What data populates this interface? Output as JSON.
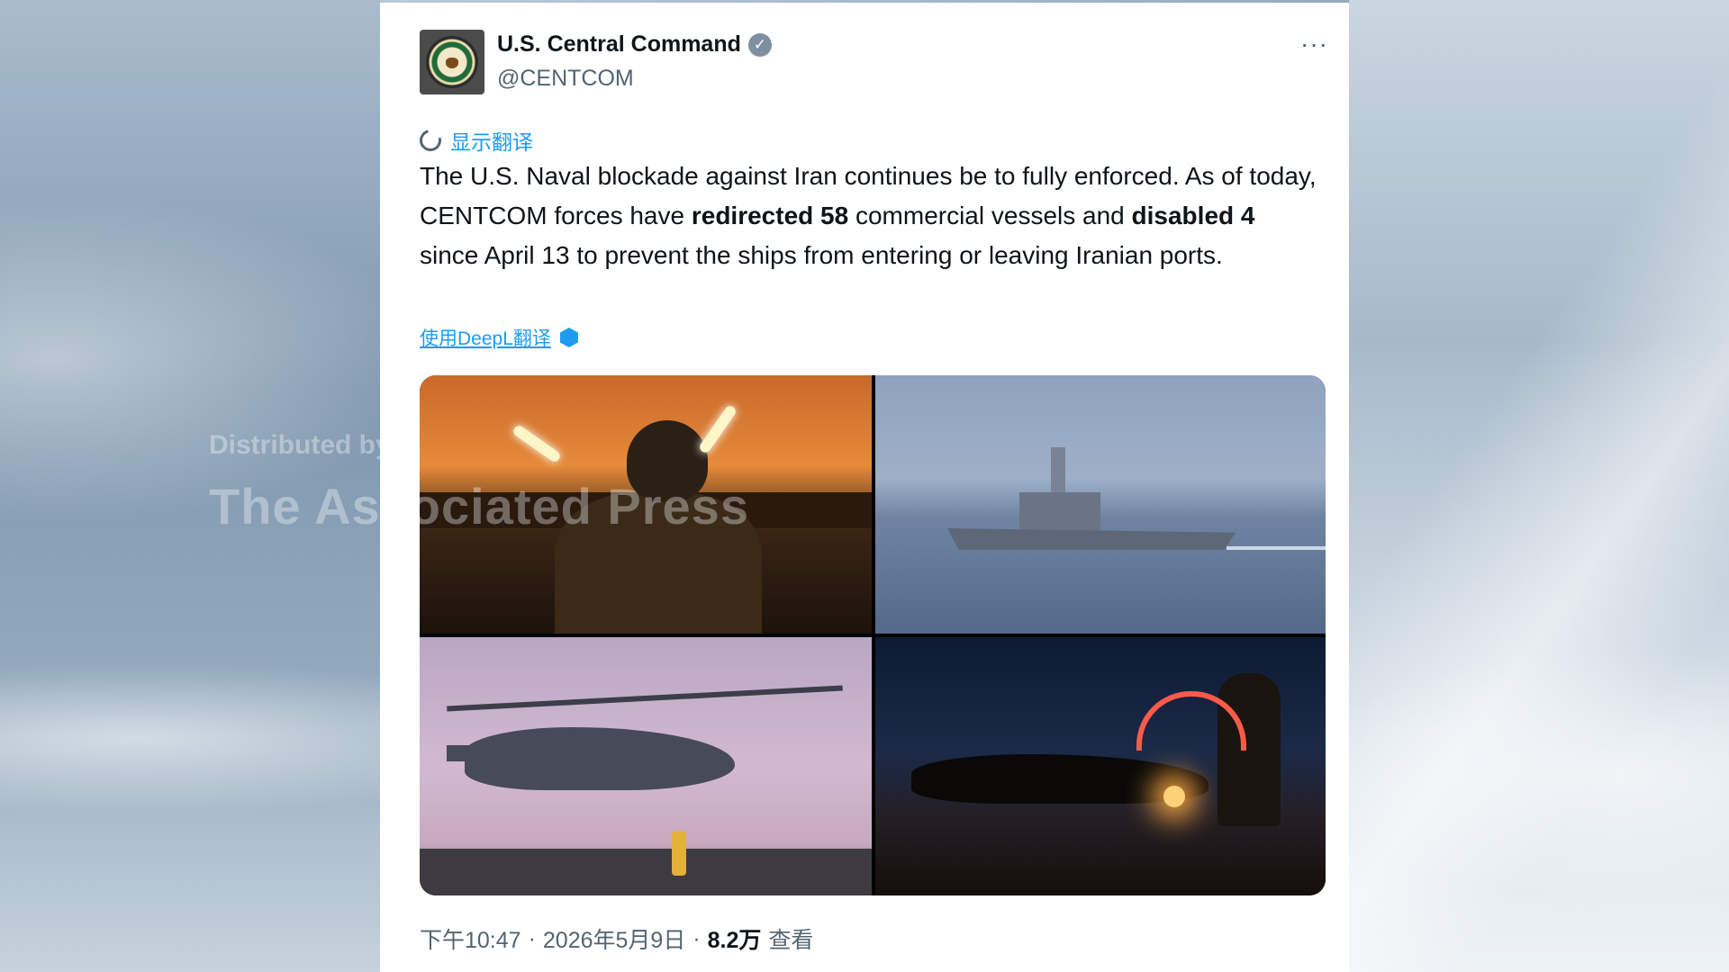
{
  "tweet": {
    "author_name": "U.S. Central Command",
    "verified_mark": "✓",
    "handle": "@CENTCOM",
    "more_label": "···",
    "show_translation": "显示翻译",
    "text_part1": "The U.S. Naval blockade against Iran continues be to fully enforced. As of today, CENTCOM forces have ",
    "bold1": "redirected 58",
    "text_part2": " commercial vessels and ",
    "bold2": "disabled 4",
    "text_part3": " since April 13 to prevent the ships from entering or leaving Iranian ports.",
    "deepl_link": "使用DeepL翻译",
    "watermark_line1": "Distributed by",
    "watermark_line2": "The Associated Press",
    "time": "下午10:47",
    "separator": "·",
    "date": "2026年5月9日",
    "views_count": "8.2万",
    "views_label": "查看"
  },
  "photos": [
    {
      "icon": "flight-deck-director-photo"
    },
    {
      "icon": "destroyer-ship-photo"
    },
    {
      "icon": "helicopter-landing-photo"
    },
    {
      "icon": "night-helicopter-photo"
    }
  ],
  "colors": {
    "link": "#1d9bf0",
    "text": "#0f1419",
    "secondary": "#536471",
    "card": "#ffffff"
  }
}
